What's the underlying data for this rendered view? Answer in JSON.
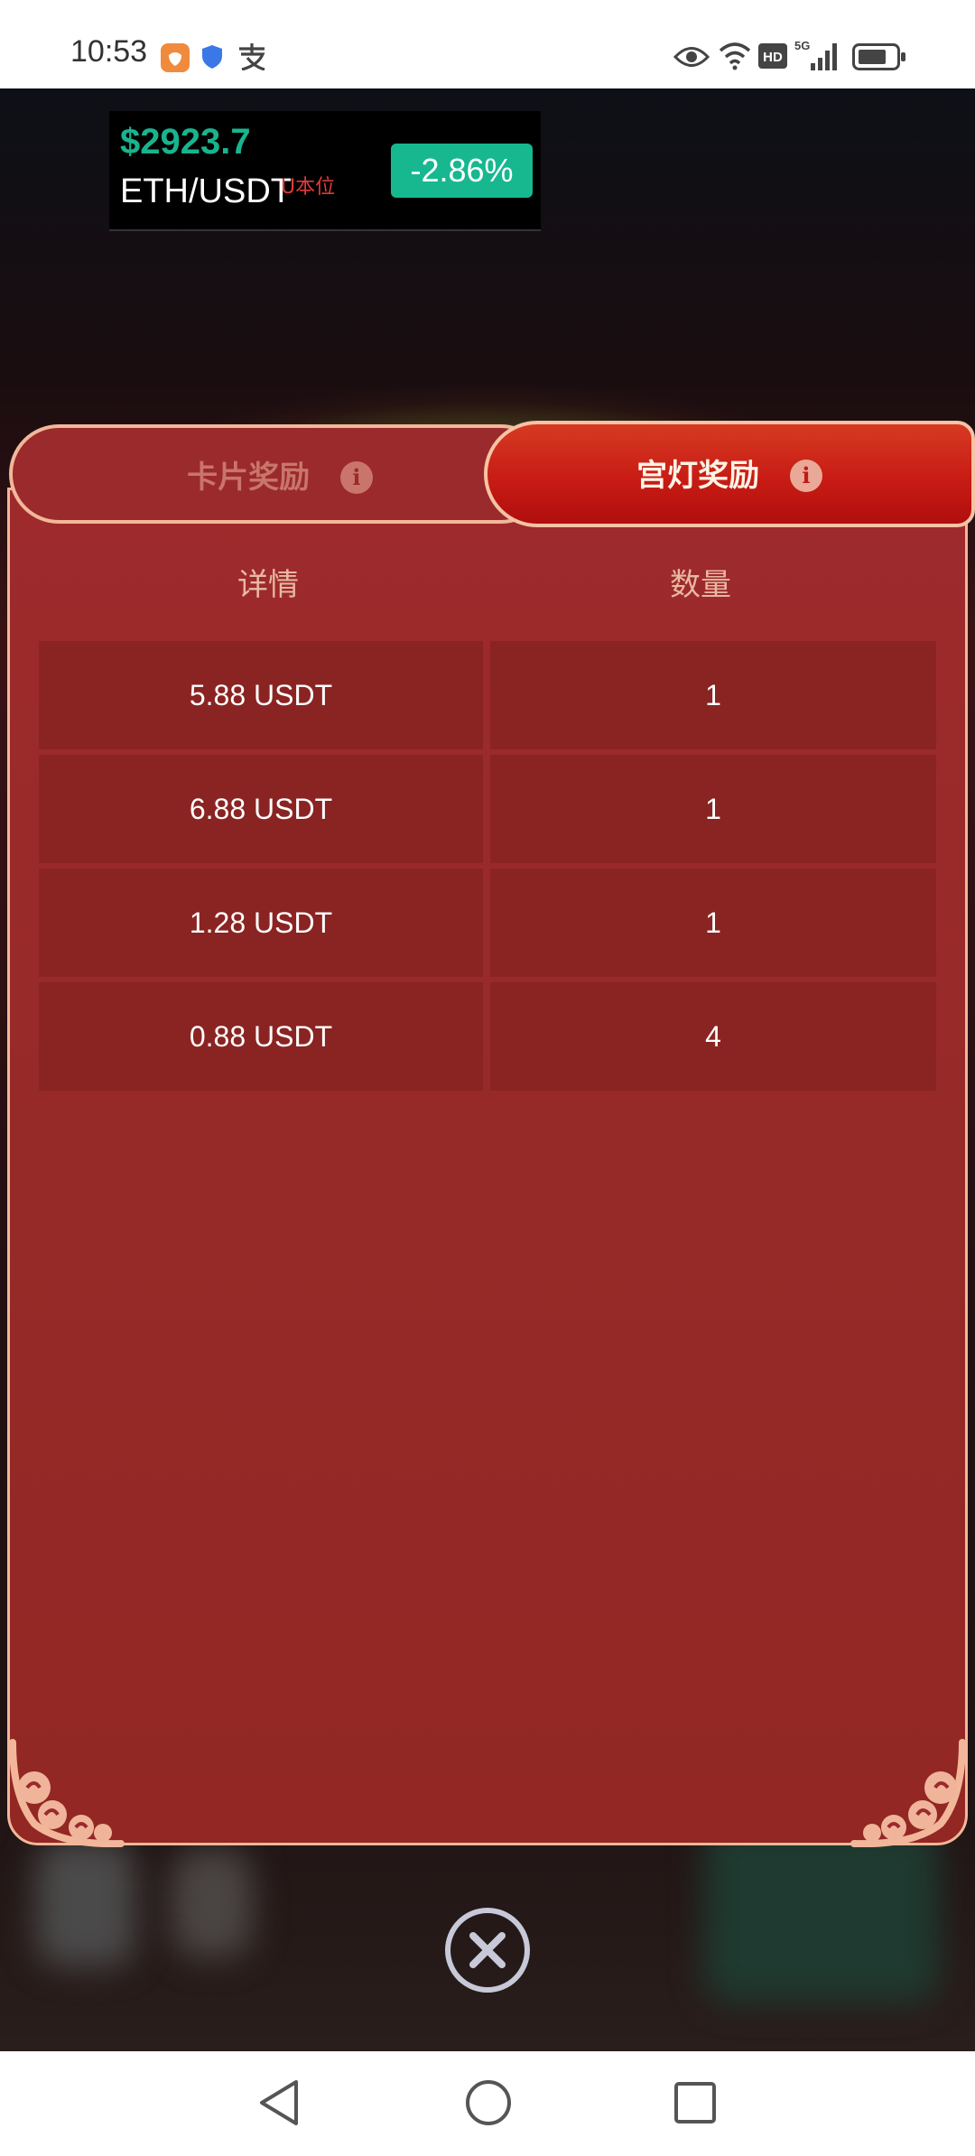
{
  "status_bar": {
    "time": "10:53",
    "icons": [
      "app-notification-icon",
      "shield-icon",
      "alipay-icon",
      "eye-icon",
      "wifi-icon",
      "hd-icon",
      "signal-5g-icon",
      "battery-icon"
    ]
  },
  "ticker": {
    "price": "$2923.7",
    "pair": "ETH/USDT",
    "tag": "U本位",
    "change": "-2.86%",
    "colors": {
      "price": "#19b48e",
      "change_bg": "#17b890",
      "tag": "#e03a3a"
    }
  },
  "modal": {
    "tabs": [
      {
        "label": "卡片奖励",
        "active": false
      },
      {
        "label": "宫灯奖励",
        "active": true
      }
    ],
    "info_icon_glyph": "i",
    "table": {
      "headers": [
        "详情",
        "数量"
      ],
      "rows": [
        [
          "5.88 USDT",
          "1"
        ],
        [
          "6.88 USDT",
          "1"
        ],
        [
          "1.28 USDT",
          "1"
        ],
        [
          "0.88 USDT",
          "4"
        ]
      ]
    }
  },
  "nav_bar": {
    "buttons": [
      "back-icon",
      "home-icon",
      "recents-icon"
    ]
  }
}
